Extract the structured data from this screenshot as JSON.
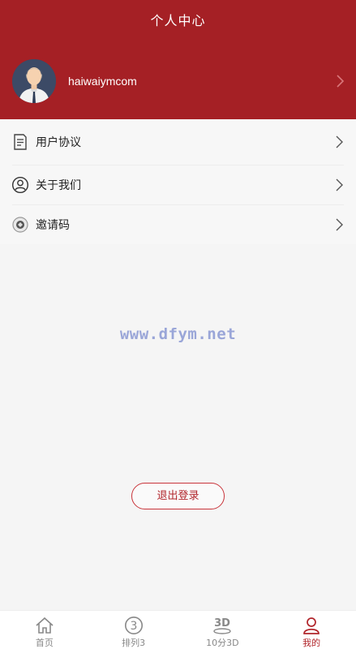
{
  "header": {
    "title": "个人中心"
  },
  "profile": {
    "username": "haiwaiymcom"
  },
  "menu": {
    "items": [
      {
        "label": "用户协议",
        "icon": "document-icon"
      },
      {
        "label": "关于我们",
        "icon": "user-circle-icon"
      },
      {
        "label": "邀请码",
        "icon": "invite-code-icon"
      }
    ]
  },
  "watermark": "www.dfym.net",
  "logout": {
    "label": "退出登录"
  },
  "tabbar": {
    "items": [
      {
        "label": "首页",
        "icon": "home-icon"
      },
      {
        "label": "排列3",
        "icon": "circle-three-icon"
      },
      {
        "label": "10分3D",
        "icon": "3d-icon"
      },
      {
        "label": "我的",
        "icon": "person-icon",
        "active": true
      }
    ]
  },
  "colors": {
    "primary": "#a52025",
    "accent": "#b1252b",
    "background": "#f5f5f5"
  }
}
